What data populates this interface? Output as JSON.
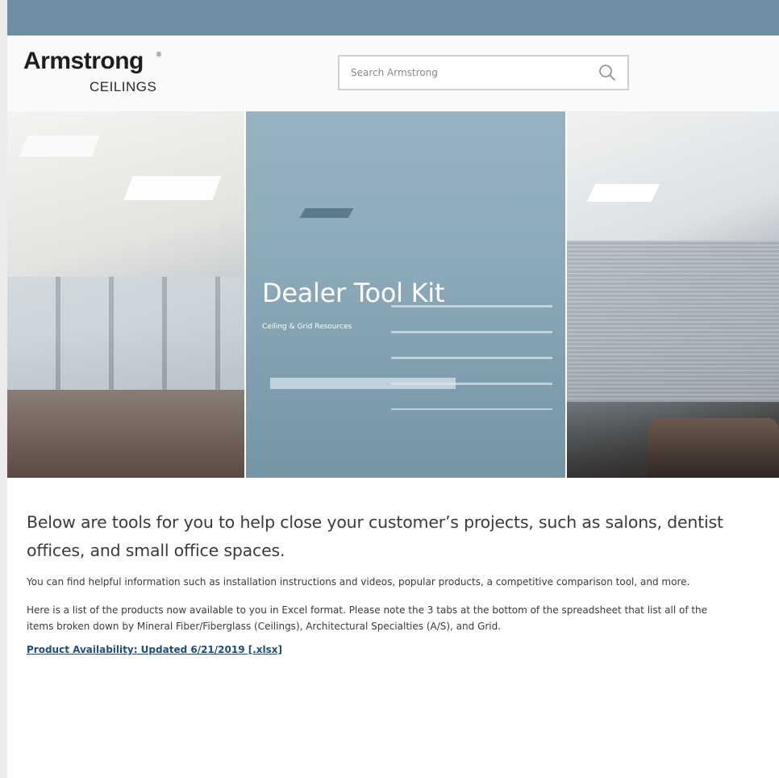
{
  "brand": {
    "name": "Armstrong",
    "registered_mark": "®",
    "subtitle": "CEILINGS"
  },
  "search": {
    "placeholder": "Search Armstrong",
    "icon": "search-icon"
  },
  "hero": {
    "title": "Dealer Tool Kit",
    "subtitle": "Ceiling & Grid Resources",
    "overlay_color": "#6e96aa"
  },
  "content": {
    "lead": "Below are tools for you to help close your customer’s projects, such as salons, dentist offices, and small office spaces.",
    "paragraph_1": "You can find helpful information such as installation instructions and videos, popular products, a competitive comparison tool, and more.",
    "paragraph_2": "Here is a list of the products now available to you in Excel format. Please note the 3 tabs at the bottom of the spreadsheet that list all of the items broken down by Mineral Fiber/Fiberglass (Ceilings), Architectural Specialties (A/S), and Grid.",
    "link_label": "Product Availability: Updated 6/21/2019 [.xlsx]"
  },
  "colors": {
    "top_bar": "#6e8ea3",
    "link": "#1f4e79"
  }
}
